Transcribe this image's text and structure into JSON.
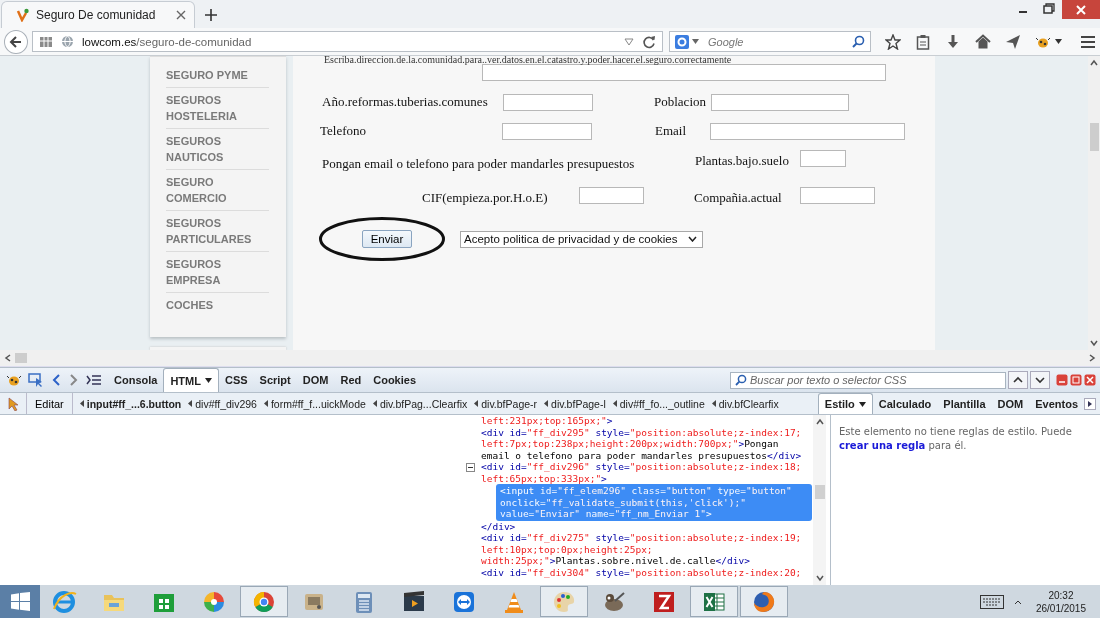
{
  "browser": {
    "tab": {
      "title": "Seguro De comunidad",
      "selected": true
    },
    "url": {
      "host": "lowcom.es",
      "path": "/seguro-de-comunidad"
    },
    "search": {
      "placeholder": "Google"
    }
  },
  "sidebar": {
    "items": [
      "SEGURO PYME",
      "SEGUROS HOSTELERIA",
      "SEGUROS NAUTICOS",
      "SEGURO COMERCIO",
      "SEGUROS PARTICULARES",
      "SEGUROS EMPRESA",
      "COCHES"
    ]
  },
  "form": {
    "heading": "Escriba.direccion.de.la.comunidad.para..ver.datos.en.el.catastro.y.poder.hacer.el.seguro.correctamente",
    "rows": [
      {
        "cells": [
          {
            "kind": "label",
            "text": "Año.reformas.tuberias.comunes"
          },
          {
            "kind": "field"
          },
          {
            "kind": "label",
            "text": "Poblacion"
          },
          {
            "kind": "field"
          }
        ]
      },
      {
        "cells": [
          {
            "kind": "label",
            "text": "Telefono"
          },
          {
            "kind": "field"
          },
          {
            "kind": "label",
            "text": "Email"
          },
          {
            "kind": "field"
          }
        ]
      },
      {
        "cells": [
          {
            "kind": "label",
            "text": "Pongan email o telefono para poder mandarles presupuestos"
          },
          {
            "kind": "label",
            "text": "Plantas.bajo.suelo"
          },
          {
            "kind": "field"
          }
        ]
      },
      {
        "cells": [
          {
            "kind": "label",
            "text": "CIF(empieza.por.H.o.E)"
          },
          {
            "kind": "field"
          },
          {
            "kind": "label",
            "text": "Compañia.actual"
          },
          {
            "kind": "field"
          }
        ]
      }
    ],
    "submit": {
      "label": "Enviar",
      "circled": true
    },
    "consent": {
      "value": "Acepto politica de privacidad y de cookies"
    }
  },
  "devtools": {
    "tabs": [
      {
        "label": "Consola",
        "selected": false,
        "menu": false
      },
      {
        "label": "HTML",
        "selected": true,
        "menu": true
      },
      {
        "label": "CSS",
        "selected": false,
        "menu": false
      },
      {
        "label": "Script",
        "selected": false,
        "menu": false
      },
      {
        "label": "DOM",
        "selected": false,
        "menu": false
      },
      {
        "label": "Red",
        "selected": false,
        "menu": false
      },
      {
        "label": "Cookies",
        "selected": false,
        "menu": false
      }
    ],
    "search": {
      "placeholder": "Buscar por texto o selector CSS"
    },
    "edit_button": "Editar",
    "breadcrumbs": [
      {
        "label": "input#ff_...6.button",
        "selected": true
      },
      {
        "label": "div#ff_div296",
        "selected": false
      },
      {
        "label": "form#ff_f...uickMode",
        "selected": false
      },
      {
        "label": "div.bfPag...Clearfix",
        "selected": false
      },
      {
        "label": "div.bfPage-r",
        "selected": false
      },
      {
        "label": "div.bfPage-l",
        "selected": false
      },
      {
        "label": "div#ff_fo..._outline",
        "selected": false
      },
      {
        "label": "div.bfClearfix",
        "selected": false
      }
    ],
    "side_tabs": [
      {
        "label": "Estilo",
        "selected": true,
        "menu": true
      },
      {
        "label": "Calculado",
        "selected": false,
        "menu": false
      },
      {
        "label": "Plantilla",
        "selected": false,
        "menu": false
      },
      {
        "label": "DOM",
        "selected": false,
        "menu": false
      },
      {
        "label": "Eventos",
        "selected": false,
        "menu": false
      }
    ],
    "nodes": [
      {
        "selected": false,
        "parts": [
          {
            "kind": "value",
            "text": "left:231px;top:165px;\""
          },
          {
            "kind": "tag",
            "text": ">"
          }
        ]
      },
      {
        "selected": false,
        "parts": [
          {
            "kind": "tag",
            "text": "<div"
          },
          {
            "kind": "attr",
            "text": " id="
          },
          {
            "kind": "value",
            "text": "\"ff_div295\""
          },
          {
            "kind": "attr",
            "text": " style="
          },
          {
            "kind": "value",
            "text": "\"position:absolute;z-index:17; left:7px;top:238px;height:200px;width:700px;\""
          },
          {
            "kind": "tag",
            "text": ">"
          },
          {
            "kind": "text",
            "text": "Pongan email o telefono para poder mandarles presupuestos"
          },
          {
            "kind": "tag",
            "text": "</div>"
          }
        ]
      },
      {
        "selected": false,
        "expanded": true,
        "parts": [
          {
            "kind": "tag",
            "text": "<div"
          },
          {
            "kind": "attr",
            "text": " id="
          },
          {
            "kind": "value",
            "text": "\"ff_div296\""
          },
          {
            "kind": "attr",
            "text": " style="
          },
          {
            "kind": "value",
            "text": "\"position:absolute;z-index:18; left:65px;top:333px;\""
          },
          {
            "kind": "tag",
            "text": ">"
          }
        ],
        "children": [
          {
            "selected": true,
            "parts": [
              {
                "kind": "tag",
                "text": "<input"
              },
              {
                "kind": "attr",
                "text": " id="
              },
              {
                "kind": "value",
                "text": "\"ff_elem296\""
              },
              {
                "kind": "attr",
                "text": " class="
              },
              {
                "kind": "value",
                "text": "\"button\""
              },
              {
                "kind": "attr",
                "text": " type="
              },
              {
                "kind": "value",
                "text": "\"button\""
              },
              {
                "kind": "attr",
                "text": " onclick="
              },
              {
                "kind": "value",
                "text": "\"ff_validate_submit(this,'click');\""
              },
              {
                "kind": "attr",
                "text": " value="
              },
              {
                "kind": "value",
                "text": "\"Enviar\""
              },
              {
                "kind": "attr",
                "text": " name="
              },
              {
                "kind": "value",
                "text": "\"ff_nm_Enviar 1\""
              },
              {
                "kind": "tag",
                "text": ">"
              }
            ]
          }
        ],
        "close": [
          {
            "kind": "tag",
            "text": "</div>"
          }
        ]
      },
      {
        "selected": false,
        "parts": [
          {
            "kind": "tag",
            "text": "<div"
          },
          {
            "kind": "attr",
            "text": " id="
          },
          {
            "kind": "value",
            "text": "\"ff_div275\""
          },
          {
            "kind": "attr",
            "text": " style="
          },
          {
            "kind": "value",
            "text": "\"position:absolute;z-index:19; left:10px;top:0px;height:25px; width:25px;\""
          },
          {
            "kind": "tag",
            "text": ">"
          },
          {
            "kind": "text",
            "text": "Plantas.sobre.nivel.de.calle"
          },
          {
            "kind": "tag",
            "text": "</div>"
          }
        ]
      },
      {
        "selected": false,
        "parts": [
          {
            "kind": "tag",
            "text": "<div"
          },
          {
            "kind": "attr",
            "text": " id="
          },
          {
            "kind": "value",
            "text": "\"ff_div304\""
          },
          {
            "kind": "attr",
            "text": " style="
          },
          {
            "kind": "value",
            "text": "\"position:absolute;z-index:20;"
          }
        ]
      }
    ],
    "side_message": {
      "before": "Este elemento no tiene reglas de estilo. Puede ",
      "link": "crear una regla",
      "after": " para él."
    }
  },
  "taskbar": {
    "apps": [
      {
        "kind": "ie",
        "running": false
      },
      {
        "kind": "folder",
        "running": false
      },
      {
        "kind": "store",
        "running": false
      },
      {
        "kind": "pinwheel",
        "running": false
      },
      {
        "kind": "chrome",
        "running": true
      },
      {
        "kind": "scanner",
        "running": false
      },
      {
        "kind": "calculator",
        "running": false
      },
      {
        "kind": "film",
        "running": false
      },
      {
        "kind": "remote",
        "running": false
      },
      {
        "kind": "cone",
        "running": false
      },
      {
        "kind": "palette",
        "running": true
      },
      {
        "kind": "gimp",
        "running": false
      },
      {
        "kind": "filezilla",
        "running": false
      },
      {
        "kind": "sheet",
        "running": true
      },
      {
        "kind": "firefox",
        "running": true
      }
    ],
    "time": "20:32",
    "date": "26/01/2015"
  }
}
